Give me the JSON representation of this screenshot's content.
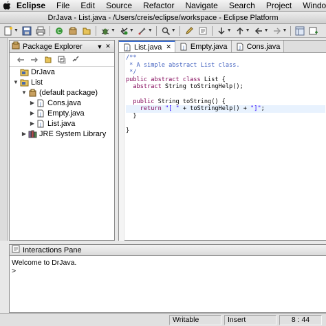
{
  "menubar": {
    "app": "Eclipse",
    "items": [
      "File",
      "Edit",
      "Source",
      "Refactor",
      "Navigate",
      "Search",
      "Project",
      "Window"
    ]
  },
  "window": {
    "title": "DrJava - List.java - /Users/creis/eclipse/workspace - Eclipse Platform"
  },
  "package_explorer": {
    "title": "Package Explorer",
    "tree": [
      {
        "label": "DrJava",
        "icon": "project-icon",
        "indent": 0,
        "twisty": ""
      },
      {
        "label": "List",
        "icon": "project-icon",
        "indent": 0,
        "twisty": "▼"
      },
      {
        "label": "(default package)",
        "icon": "package-icon",
        "indent": 1,
        "twisty": "▼"
      },
      {
        "label": "Cons.java",
        "icon": "java-file-icon",
        "indent": 2,
        "twisty": "▶"
      },
      {
        "label": "Empty.java",
        "icon": "java-file-icon",
        "indent": 2,
        "twisty": "▶"
      },
      {
        "label": "List.java",
        "icon": "java-file-icon",
        "indent": 2,
        "twisty": "▶"
      },
      {
        "label": "JRE System Library",
        "icon": "library-icon",
        "indent": 1,
        "twisty": "▶"
      }
    ]
  },
  "editor": {
    "tabs": [
      {
        "label": "List.java",
        "active": true
      },
      {
        "label": "Empty.java",
        "active": false
      },
      {
        "label": "Cons.java",
        "active": false
      }
    ],
    "lines": [
      [
        {
          "t": "/**",
          "c": "cm"
        }
      ],
      [
        {
          "t": " * A simple abstract List class.",
          "c": "cm"
        }
      ],
      [
        {
          "t": " */",
          "c": "cm"
        }
      ],
      [
        {
          "t": "public abstract class",
          "c": "kw"
        },
        {
          "t": " List {",
          "c": ""
        }
      ],
      [
        {
          "t": "  abstract",
          "c": "kw"
        },
        {
          "t": " String toStringHelp();",
          "c": ""
        }
      ],
      [
        {
          "t": "",
          "c": ""
        }
      ],
      [
        {
          "t": "  public",
          "c": "kw"
        },
        {
          "t": " String toString() {",
          "c": ""
        }
      ],
      [
        {
          "t": "    return",
          "c": "kw"
        },
        {
          "t": " ",
          "c": ""
        },
        {
          "t": "\"[ \"",
          "c": "st"
        },
        {
          "t": " + toStringHelp() + ",
          "c": ""
        },
        {
          "t": "\"]\"",
          "c": "st"
        },
        {
          "t": ";",
          "c": ""
        }
      ],
      [
        {
          "t": "  }",
          "c": ""
        }
      ],
      [
        {
          "t": "",
          "c": ""
        }
      ],
      [
        {
          "t": "}",
          "c": ""
        }
      ]
    ],
    "highlight_line": 7
  },
  "interactions": {
    "title": "Interactions Pane",
    "welcome": "Welcome to DrJava.",
    "prompt": ">"
  },
  "status": {
    "writable": "Writable",
    "mode": "Insert",
    "position": "8 : 44"
  },
  "colors": {
    "keyword": "#7f0055",
    "comment": "#3f5fbf",
    "string": "#2a00ff",
    "active_tab": "#3d6fd1"
  }
}
